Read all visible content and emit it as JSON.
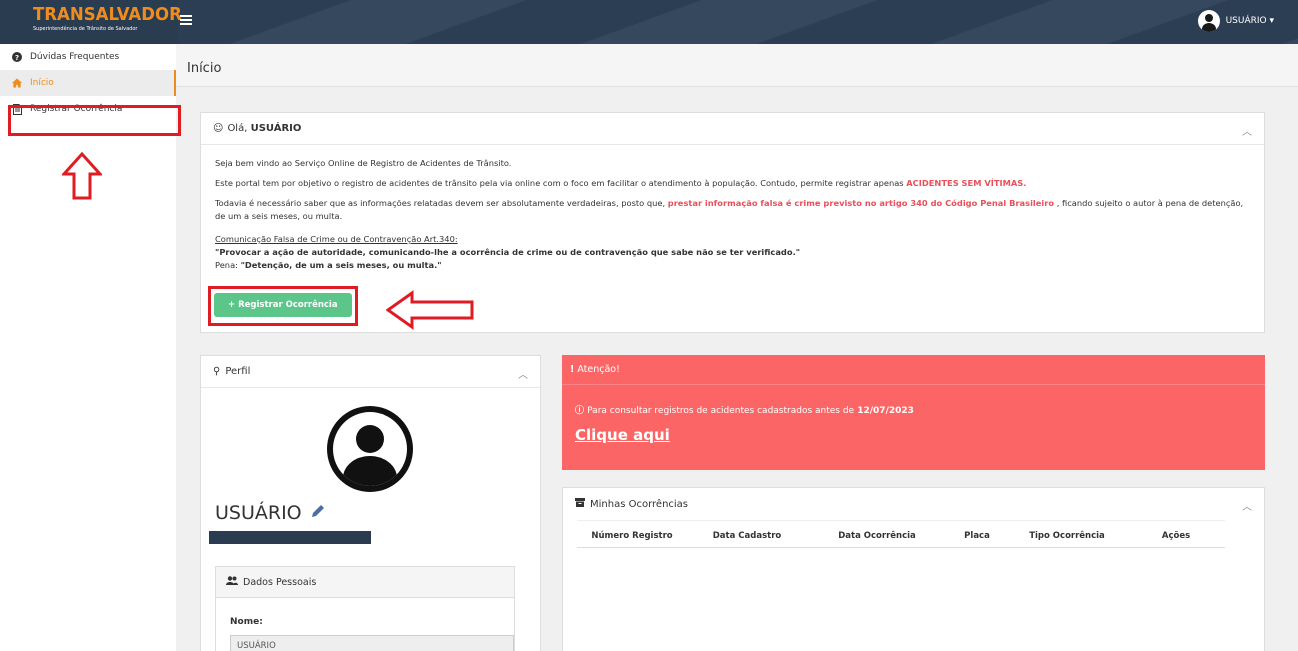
{
  "header": {
    "brand": "TRANSALVADOR",
    "brand_sub": "Superintendência de Trânsito de Salvador",
    "user": "USUÁRIO ▾"
  },
  "sidebar": {
    "items": [
      {
        "label": "Dúvidas Frequentes",
        "icon": "question-circle-icon"
      },
      {
        "label": "Início",
        "icon": "home-icon"
      },
      {
        "label": "Registrar Ocorrência",
        "icon": "document-icon"
      }
    ]
  },
  "page": {
    "title": "Início"
  },
  "welcome": {
    "greeting": "Olá,",
    "user": "USUÁRIO",
    "p1": "Seja bem vindo ao Serviço Online de Registro de Acidentes de Trânsito.",
    "p2_text": "Este portal tem por objetivo o registro de acidentes de trânsito pela via online com o foco em facilitar o atendimento à população. Contudo, permite registrar apenas",
    "p2_highlight": "ACIDENTES SEM VÍTIMAS.",
    "p3_text": "Todavia é necessário saber que as informações relatadas devem ser absolutamente verdadeiras, posto que,",
    "p3_highlight": "prestar informação falsa é crime previsto no artigo 340 do Código Penal Brasileiro",
    "p3_end": ", ficando sujeito o autor à pena de detenção, de um a seis meses, ou multa.",
    "law_title": "Comunicação Falsa de Crime ou de Contravenção Art.340:",
    "law_quote": "\"Provocar a ação de autoridade, comunicando-lhe a ocorrência de crime ou de contravenção que sabe não se ter verificado.\"",
    "penalty_label": "Pena:",
    "penalty_text": "\"Detenção, de um a seis meses, ou multa.\"",
    "button": "+ Registrar Ocorrência"
  },
  "profile": {
    "title": "Perfil",
    "name": "USUÁRIO",
    "section": "Dados Pessoais",
    "field_label": "Nome:",
    "field_value": "USUÁRIO"
  },
  "alert": {
    "title": "Atenção!",
    "message": "Para consultar registros de acidentes cadastrados antes de",
    "date": "12/07/2023",
    "link": "Clique aqui"
  },
  "occurrences": {
    "title": "Minhas Ocorrências",
    "columns": [
      "Número Registro",
      "Data Cadastro",
      "Data Ocorrência",
      "Placa",
      "Tipo Ocorrência",
      "Ações"
    ]
  },
  "colors": {
    "accent": "#f08c1e",
    "topbar": "#2d4157",
    "alert": "#fc6565",
    "button": "#5cc58a",
    "highlight": "#e01b22"
  }
}
